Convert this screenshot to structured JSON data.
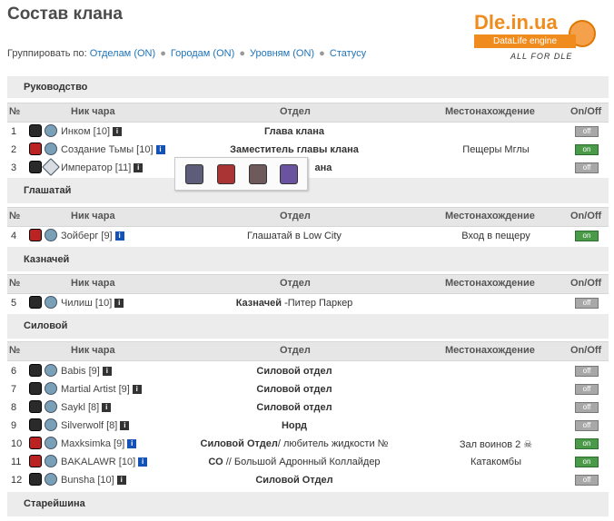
{
  "page_title": "Состав клана",
  "group_by": {
    "label": "Группировать по:",
    "links": [
      {
        "text": "Отделам",
        "state": "(ON)"
      },
      {
        "text": "Городам",
        "state": "(ON)"
      },
      {
        "text": "Уровням",
        "state": "(ON)"
      },
      {
        "text": "Статусу",
        "state": ""
      }
    ]
  },
  "logo": {
    "name": "Dle.in.ua",
    "bar": "DataLife engine",
    "tagline": "ALL FOR DLE"
  },
  "columns": {
    "num": "№",
    "nick": "Ник чара",
    "dept": "Отдел",
    "loc": "Местонахождение",
    "status": "On/Off"
  },
  "status_labels": {
    "on": "on",
    "off": "off"
  },
  "sections": [
    {
      "name": "Руководство"
    },
    {
      "name": "Глашатай"
    },
    {
      "name": "Казначей"
    },
    {
      "name": "Силовой"
    },
    {
      "name": "Старейшина"
    }
  ],
  "members": [
    {
      "num": "1",
      "nick": "Инком [10]",
      "dept_bold": "Глава клана",
      "dept_rest": "",
      "loc": "",
      "status": "off"
    },
    {
      "num": "2",
      "nick": "Создание Тьмы [10]",
      "dept_bold": "Заместитель главы клана",
      "dept_rest": "",
      "loc": "Пещеры Мглы",
      "status": "on"
    },
    {
      "num": "3",
      "nick": "Император [11]",
      "dept_bold": "",
      "dept_rest": "ана",
      "loc": "",
      "status": "off"
    },
    {
      "num": "4",
      "nick": "Зойберг [9]",
      "dept_bold": "",
      "dept_rest": "Глашатай в Low City",
      "loc": "Вход в пещеру",
      "status": "on"
    },
    {
      "num": "5",
      "nick": "Чилиш [10]",
      "dept_bold": "Казначей",
      "dept_rest": " -Питер Паркер",
      "loc": "",
      "status": "off"
    },
    {
      "num": "6",
      "nick": "Babis [9]",
      "dept_bold": "Силовой отдел",
      "dept_rest": "",
      "loc": "",
      "status": "off"
    },
    {
      "num": "7",
      "nick": "Martial Artist [9]",
      "dept_bold": "Силовой отдел",
      "dept_rest": "",
      "loc": "",
      "status": "off"
    },
    {
      "num": "8",
      "nick": "Saykl [8]",
      "dept_bold": "Силовой отдел",
      "dept_rest": "",
      "loc": "",
      "status": "off"
    },
    {
      "num": "9",
      "nick": "Silverwolf [8]",
      "dept_bold": "Норд",
      "dept_rest": "",
      "loc": "",
      "status": "off"
    },
    {
      "num": "10",
      "nick": "Maxksimka [9]",
      "dept_bold": "Силовой Отдел",
      "dept_rest": "/ любитель жидкости №",
      "loc": "Зал воинов 2 ☠",
      "status": "on"
    },
    {
      "num": "11",
      "nick": "BAKALAWR [10]",
      "dept_bold": "СО",
      "dept_rest": " // Большой Адронный Коллайдер",
      "loc": "Катакомбы",
      "status": "on"
    },
    {
      "num": "12",
      "nick": "Bunsha [10]",
      "dept_bold": "Силовой Отдел",
      "dept_rest": "",
      "loc": "",
      "status": "off"
    }
  ]
}
